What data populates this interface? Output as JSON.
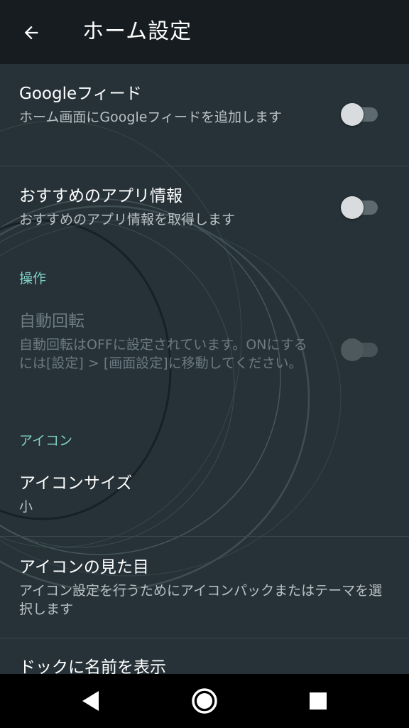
{
  "appbar": {
    "title": "ホーム設定",
    "back_icon": "arrow-left-icon"
  },
  "items": {
    "google_feed": {
      "title": "Googleフィード",
      "subtitle": "ホーム画面にGoogleフィードを追加します",
      "enabled": false
    },
    "recommended_apps": {
      "title": "おすすめのアプリ情報",
      "subtitle": "おすすめのアプリ情報を取得します",
      "enabled": false
    },
    "auto_rotate": {
      "title": "自動回転",
      "subtitle": "自動回転はOFFに設定されています。ONにするには[設定] > [画面設定]に移動してください。",
      "enabled": false,
      "disabled": true
    },
    "icon_size": {
      "title": "アイコンサイズ",
      "value": "小"
    },
    "icon_look": {
      "title": "アイコンの見た目",
      "subtitle": "アイコン設定を行うためにアイコンパックまたはテーマを選択します"
    },
    "dock_labels": {
      "title": "ドックに名前を表示"
    }
  },
  "sections": {
    "operation": "操作",
    "icons": "アイコン"
  },
  "navbar": {
    "back_icon": "triangle-back-icon",
    "home_icon": "circle-home-icon",
    "recents_icon": "square-recents-icon"
  },
  "colors": {
    "accent": "#7fcfc4",
    "background": "#263238",
    "appbar": "#161c1f"
  }
}
